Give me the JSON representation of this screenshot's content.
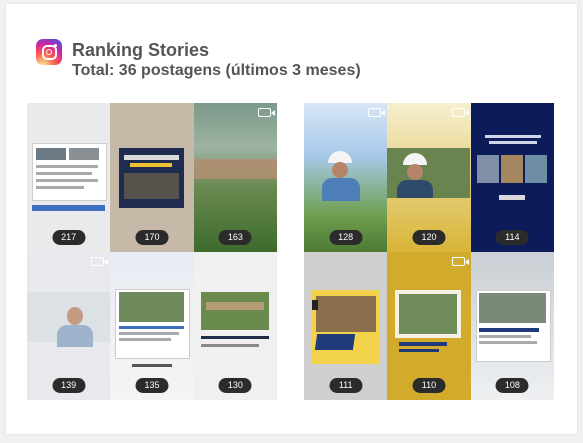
{
  "header": {
    "title": "Ranking Stories",
    "subtitle": "Total: 36 postagens (últimos 3 meses)"
  },
  "stories": [
    {
      "views": "217",
      "video": false
    },
    {
      "views": "170",
      "video": false
    },
    {
      "views": "163",
      "video": true
    },
    {
      "views": "139",
      "video": true
    },
    {
      "views": "135",
      "video": false
    },
    {
      "views": "130",
      "video": false
    },
    {
      "views": "128",
      "video": true
    },
    {
      "views": "120",
      "video": true
    },
    {
      "views": "114",
      "video": false
    },
    {
      "views": "111",
      "video": false
    },
    {
      "views": "110",
      "video": true
    },
    {
      "views": "108",
      "video": false
    }
  ],
  "colors": {
    "title": "#555555",
    "badge": "#2b2b2b",
    "accent_yellow": "#d8b436",
    "accent_navy": "#0c1c5a"
  }
}
